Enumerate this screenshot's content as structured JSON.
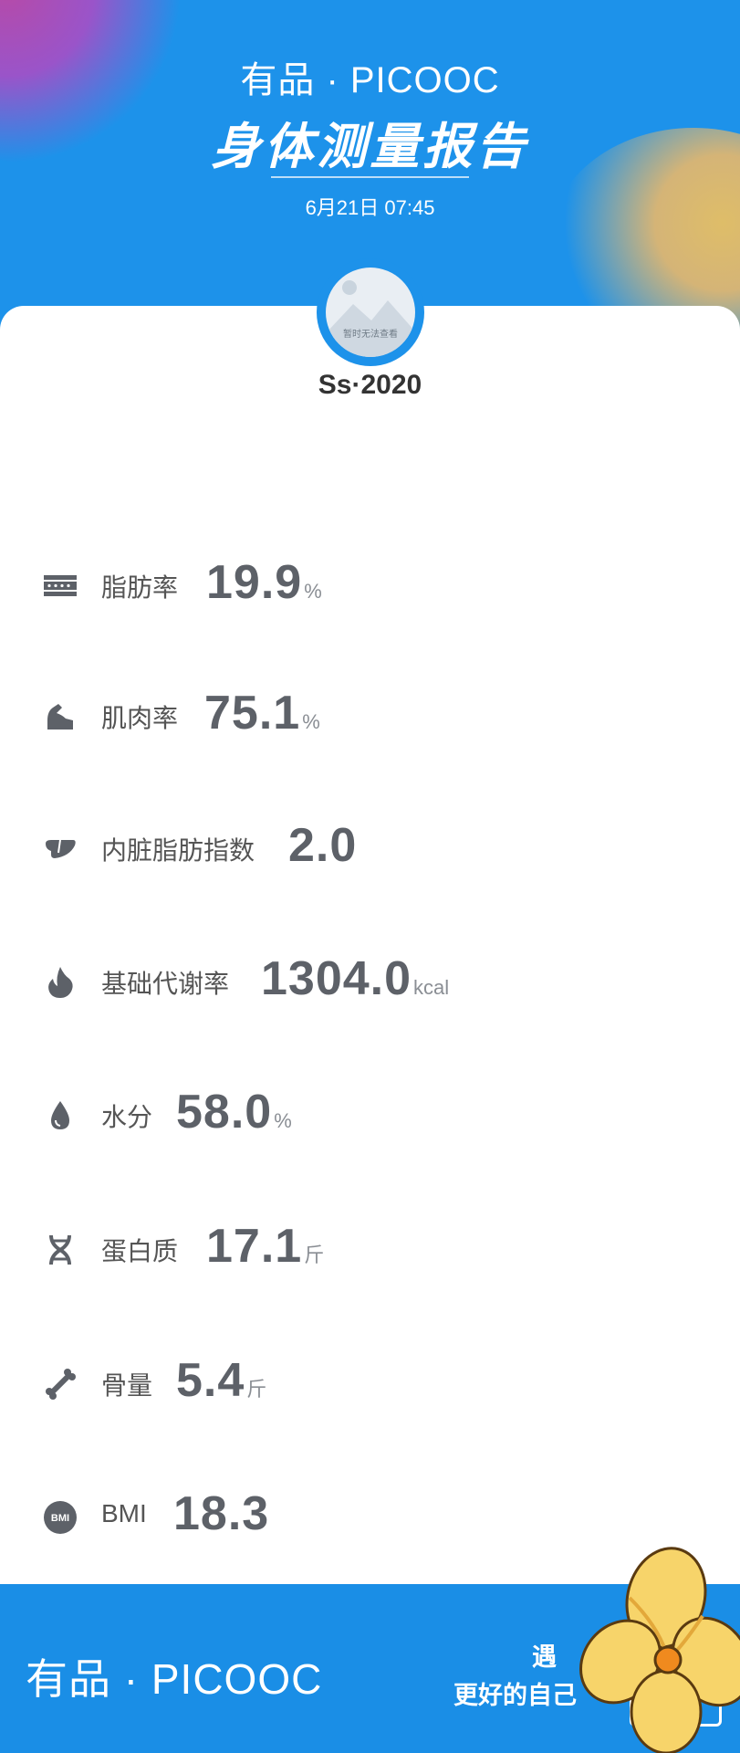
{
  "header": {
    "brand": "有品 · PICOOC",
    "title": "身体测量报告",
    "date": "6月21日 07:45"
  },
  "profile": {
    "avatar_caption": "暂时无法查看",
    "username": "Ss·2020"
  },
  "metrics": [
    {
      "label": "脂肪率",
      "value": "19.9",
      "unit": "%",
      "icon": "fat-layer-icon"
    },
    {
      "label": "肌肉率",
      "value": "75.1",
      "unit": "%",
      "icon": "muscle-arm-icon"
    },
    {
      "label": "内脏脂肪指数",
      "value": "2.0",
      "unit": "",
      "icon": "liver-organ-icon"
    },
    {
      "label": "基础代谢率",
      "value": "1304.0",
      "unit": "kcal",
      "icon": "flame-icon"
    },
    {
      "label": "水分",
      "value": "58.0",
      "unit": "%",
      "icon": "water-drop-icon"
    },
    {
      "label": "蛋白质",
      "value": "17.1",
      "unit": "斤",
      "icon": "dna-icon"
    },
    {
      "label": "骨量",
      "value": "5.4",
      "unit": "斤",
      "icon": "bone-icon"
    },
    {
      "label": "BMI",
      "value": "18.3",
      "unit": "",
      "icon": "bmi-badge-icon",
      "icon_text": "BMI"
    }
  ],
  "footer": {
    "brand": "有品 · PICOOC",
    "slogan_line1": "遇",
    "slogan_line2": "更好的自己"
  },
  "colors": {
    "primary": "#1d92ea",
    "metric_value": "#5d6168",
    "label": "#555555"
  }
}
